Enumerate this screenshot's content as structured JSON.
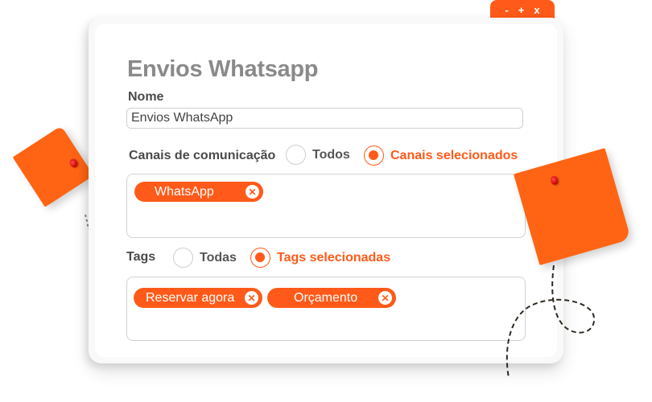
{
  "window": {
    "controls": {
      "minimize": "-",
      "maximize": "+",
      "close": "x"
    }
  },
  "form": {
    "title": "Envios Whatsapp",
    "name_label": "Nome",
    "name_value": "Envios WhatsApp",
    "channels": {
      "label": "Canais de comunicação",
      "options": [
        {
          "label": "Todos",
          "checked": false
        },
        {
          "label": "Canais selecionados",
          "checked": true
        }
      ],
      "selected": [
        {
          "label": "WhatsApp",
          "remove_icon": "close-icon"
        }
      ]
    },
    "tags": {
      "label": "Tags",
      "options": [
        {
          "label": "Todas",
          "checked": false
        },
        {
          "label": "Tags selecionadas",
          "checked": true
        }
      ],
      "selected": [
        {
          "label": "Reservar agora",
          "remove_icon": "close-icon"
        },
        {
          "label": "Orçamento",
          "remove_icon": "close-icon"
        }
      ]
    }
  },
  "colors": {
    "accent": "#ff5a19",
    "sticky_note": "#ff6414",
    "title_gray": "#8a8a8a"
  }
}
